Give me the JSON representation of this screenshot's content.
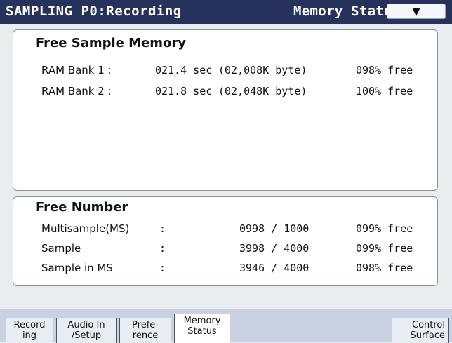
{
  "header": {
    "title": "SAMPLING P0:Recording",
    "page": "Memory Status",
    "menu_icon": "chevron-down-icon"
  },
  "free_sample_memory": {
    "title": "Free Sample Memory",
    "rows": [
      {
        "label": "RAM Bank 1 :",
        "time": "021.4 sec",
        "bytes": "(02,008K byte)",
        "free": "098% free"
      },
      {
        "label": "RAM Bank 2 :",
        "time": "021.8 sec",
        "bytes": "(02,048K byte)",
        "free": "100% free"
      }
    ]
  },
  "free_number": {
    "title": "Free Number",
    "rows": [
      {
        "label": "Multisample(MS)",
        "sep": ":",
        "count": "0998 / 1000",
        "free": "099% free"
      },
      {
        "label": "Sample",
        "sep": ":",
        "count": "3998 / 4000",
        "free": "099% free"
      },
      {
        "label": "Sample in MS",
        "sep": ":",
        "count": "3946 / 4000",
        "free": "098% free"
      }
    ]
  },
  "tabs": [
    {
      "line1": "Record",
      "line2": "ing"
    },
    {
      "line1": "Audio In",
      "line2": "/Setup"
    },
    {
      "line1": "Prefe-",
      "line2": "rence"
    },
    {
      "line1": "Memory",
      "line2": "Status"
    },
    {
      "line1": "Control",
      "line2": "Surface"
    }
  ],
  "colors": {
    "title_bar": "#26325c",
    "tab_bar": "#c9d2e3",
    "panel": "#ffffff"
  }
}
